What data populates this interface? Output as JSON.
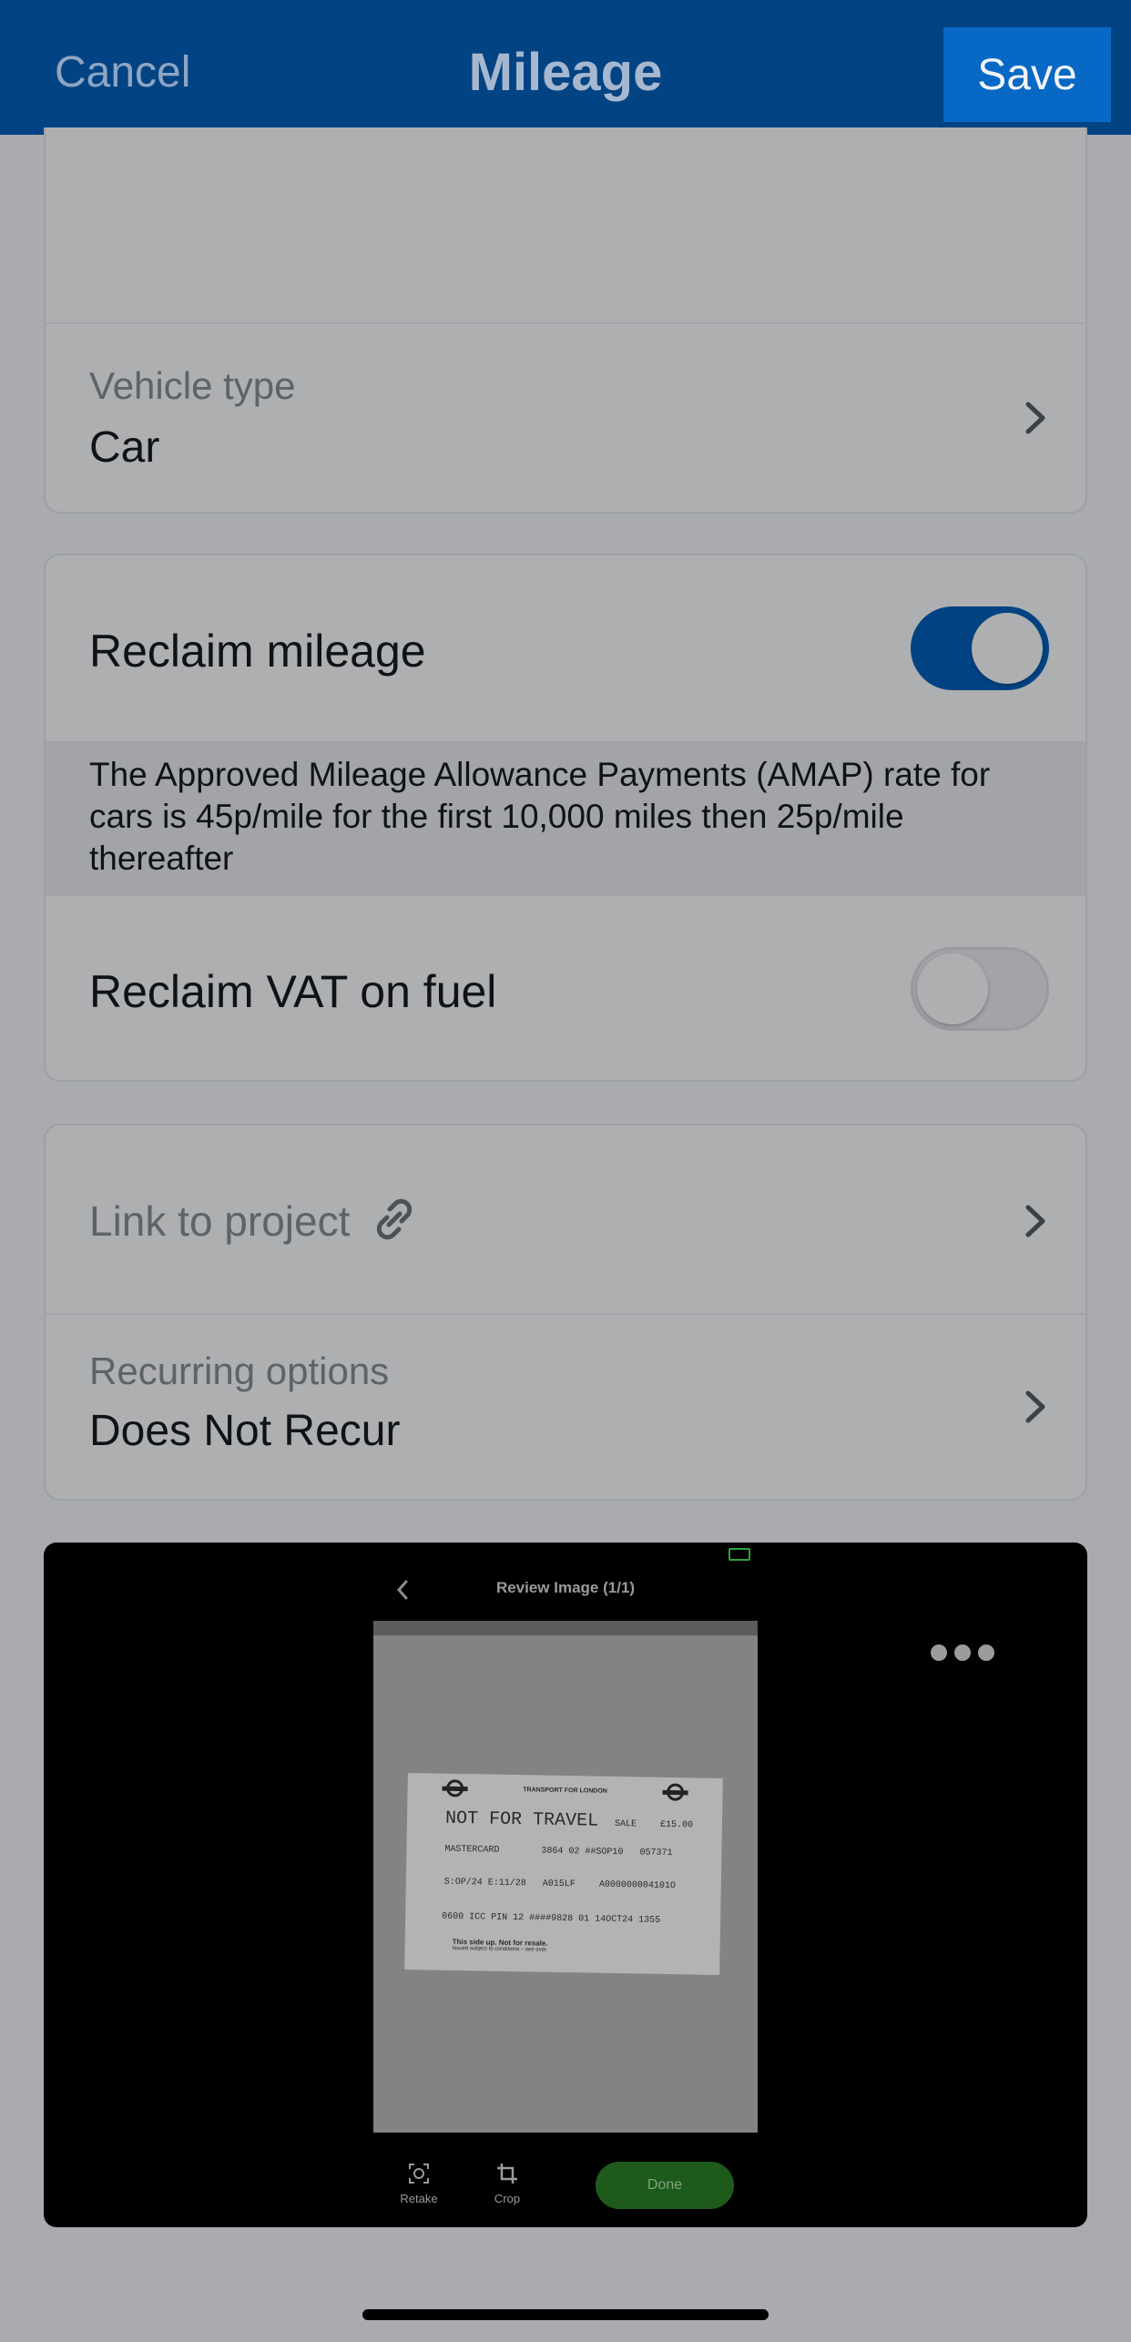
{
  "nav": {
    "cancel": "Cancel",
    "title": "Mileage",
    "save": "Save"
  },
  "vehicle": {
    "label": "Vehicle type",
    "value": "Car"
  },
  "reclaim": {
    "mileage_label": "Reclaim mileage",
    "mileage_on": true,
    "amap_info": "The Approved Mileage Allowance Payments (AMAP) rate for cars is 45p/mile for the first 10,000 miles then 25p/mile thereafter",
    "vat_label": "Reclaim VAT on fuel",
    "vat_on": false
  },
  "options": {
    "link_project": "Link to project",
    "recurring_label": "Recurring options",
    "recurring_value": "Does Not Recur"
  },
  "attachment": {
    "review_title": "Review Image (1/1)",
    "retake": "Retake",
    "crop": "Crop",
    "done": "Done",
    "receipt": {
      "header_logo_text": "TRANSPORT FOR LONDON",
      "line1": "NOT FOR TRAVEL",
      "line1_right": "SALE",
      "line1_price": "£15.00",
      "line2": "MASTERCARD",
      "line2_mid": "3864 02 ##SOP10",
      "line2_right": "057371",
      "line3": "S:OP/24 E:11/28",
      "line3_mid": "A015LF",
      "line3_right": "A000000004101O",
      "line4": "0600 ICC PIN 12 ####9828 01 14OCT24 1355",
      "footer": "This side up. Not for resale.",
      "footer_sub": "Issued subject to conditions – see over."
    }
  },
  "colors": {
    "nav_bg": "#024383",
    "save_bg": "#0768c5",
    "toggle_on": "#024383",
    "done_bg": "#1e5a1c",
    "page_bg": "#a9abaf"
  }
}
